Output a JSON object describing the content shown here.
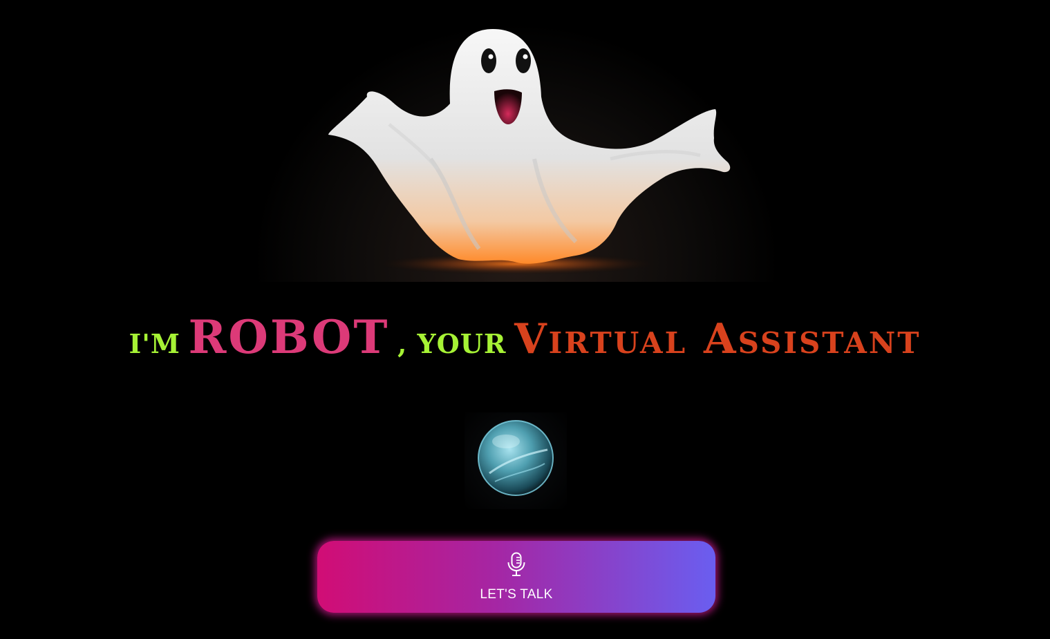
{
  "hero": {
    "image": "ghost-illustration",
    "accent_glow": "#ff7a1a"
  },
  "headline": {
    "prefix": "I'M",
    "name": "ROBOT",
    "middle": ", YOUR",
    "role": "Virtual Assistant",
    "colors": {
      "prefix": "#a6f235",
      "name": "#dc3a78",
      "role": "#d8421d"
    }
  },
  "orb": {
    "icon": "voice-orb-icon",
    "color": "#6fd3e6"
  },
  "talk_button": {
    "label": "LET'S TALK",
    "icon": "microphone-icon",
    "gradient_start": "#d10d75",
    "gradient_end": "#6a5ef0"
  }
}
